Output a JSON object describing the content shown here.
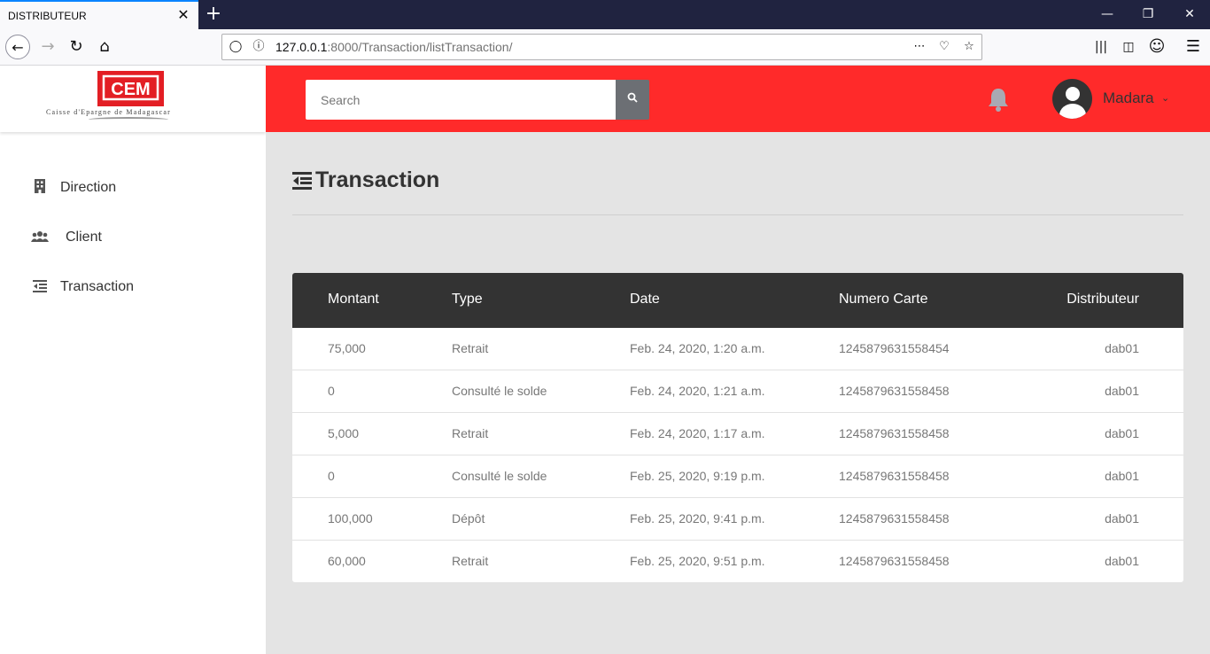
{
  "browser": {
    "tab_title": "DISTRIBUTEUR",
    "tab_close": "✕",
    "new_tab": "+",
    "url_host": "127.0.0.1",
    "url_path": ":8000/Transaction/listTransaction/",
    "window_buttons": [
      "—",
      "❐",
      "✕"
    ]
  },
  "logo": {
    "tagline": "Caisse d'Epargne de Madagascar",
    "mark": "CEM"
  },
  "sidebar": {
    "items": [
      {
        "label": "Direction",
        "icon": "building-icon"
      },
      {
        "label": "Client",
        "icon": "users-icon"
      },
      {
        "label": "Transaction",
        "icon": "list-indent-icon"
      }
    ]
  },
  "header": {
    "search_placeholder": "Search",
    "username": "Madara",
    "accent_color": "#ff2a2a"
  },
  "main": {
    "title": "Transaction",
    "table": {
      "columns": [
        "Montant",
        "Type",
        "Date",
        "Numero Carte",
        "Distributeur"
      ],
      "rows": [
        [
          "75,000",
          "Retrait",
          "Feb. 24, 2020, 1:20 a.m.",
          "1245879631558454",
          "dab01"
        ],
        [
          "0",
          "Consulté le solde",
          "Feb. 24, 2020, 1:21 a.m.",
          "1245879631558458",
          "dab01"
        ],
        [
          "5,000",
          "Retrait",
          "Feb. 24, 2020, 1:17 a.m.",
          "1245879631558458",
          "dab01"
        ],
        [
          "0",
          "Consulté le solde",
          "Feb. 25, 2020, 9:19 p.m.",
          "1245879631558458",
          "dab01"
        ],
        [
          "100,000",
          "Dépôt",
          "Feb. 25, 2020, 9:41 p.m.",
          "1245879631558458",
          "dab01"
        ],
        [
          "60,000",
          "Retrait",
          "Feb. 25, 2020, 9:51 p.m.",
          "1245879631558458",
          "dab01"
        ]
      ]
    }
  }
}
